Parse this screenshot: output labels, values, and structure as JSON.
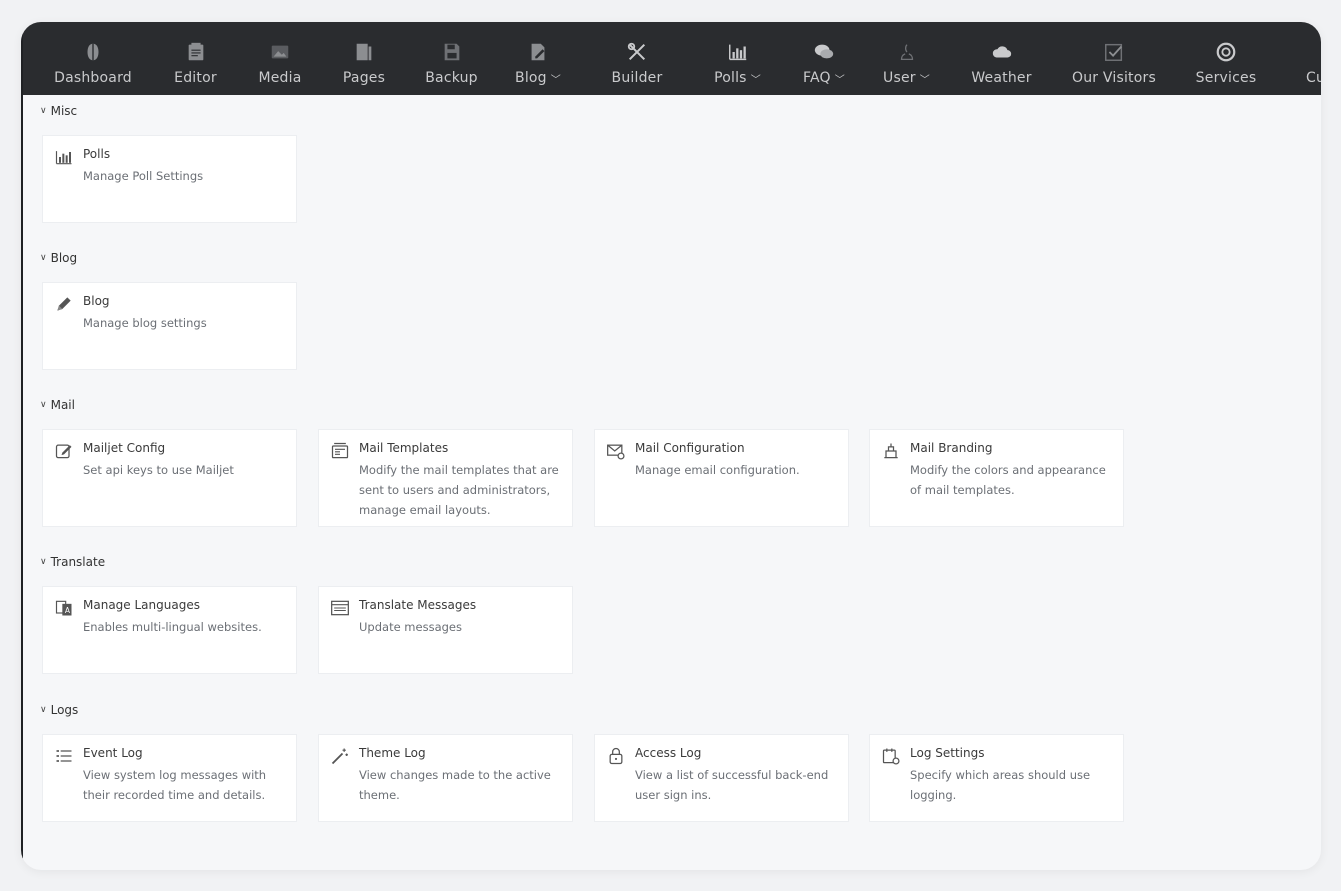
{
  "nav": {
    "items": [
      {
        "label": "Dashboard",
        "icon": "dashboard-icon",
        "caret": false
      },
      {
        "label": "Editor",
        "icon": "editor-icon",
        "caret": false
      },
      {
        "label": "Media",
        "icon": "media-icon",
        "caret": false
      },
      {
        "label": "Pages",
        "icon": "pages-icon",
        "caret": false
      },
      {
        "label": "Backup",
        "icon": "backup-icon",
        "caret": false
      },
      {
        "label": "Blog",
        "icon": "blog-icon",
        "caret": true
      },
      {
        "label": "Builder",
        "icon": "builder-icon",
        "caret": false
      },
      {
        "label": "Polls",
        "icon": "polls-icon",
        "caret": true
      },
      {
        "label": "FAQ",
        "icon": "faq-icon",
        "caret": true
      },
      {
        "label": "User",
        "icon": "user-icon",
        "caret": true
      },
      {
        "label": "Weather",
        "icon": "weather-icon",
        "caret": false
      },
      {
        "label": "Our Visitors",
        "icon": "visitors-icon",
        "caret": false
      },
      {
        "label": "Services",
        "icon": "services-icon",
        "caret": false
      },
      {
        "label": "Custo",
        "icon": "",
        "caret": false
      }
    ]
  },
  "sections": [
    {
      "label": "Misc",
      "cards": [
        {
          "title": "Polls",
          "desc": "Manage Poll Settings",
          "icon": "polls-icon"
        }
      ]
    },
    {
      "label": "Blog",
      "cards": [
        {
          "title": "Blog",
          "desc": "Manage blog settings",
          "icon": "pencil-icon"
        }
      ]
    },
    {
      "label": "Mail",
      "cards": [
        {
          "title": "Mailjet Config",
          "desc": "Set api keys to use Mailjet",
          "icon": "edit-icon"
        },
        {
          "title": "Mail Templates",
          "desc": "Modify the mail templates that are sent to users and administrators, manage email layouts.",
          "icon": "mail-templates-icon"
        },
        {
          "title": "Mail Configuration",
          "desc": "Manage email configuration.",
          "icon": "mail-config-icon"
        },
        {
          "title": "Mail Branding",
          "desc": "Modify the colors and appearance of mail templates.",
          "icon": "mail-branding-icon"
        }
      ]
    },
    {
      "label": "Translate",
      "cards": [
        {
          "title": "Manage Languages",
          "desc": "Enables multi-lingual websites.",
          "icon": "languages-icon"
        },
        {
          "title": "Translate Messages",
          "desc": "Update messages",
          "icon": "translate-messages-icon"
        }
      ]
    },
    {
      "label": "Logs",
      "cards": [
        {
          "title": "Event Log",
          "desc": "View system log messages with their recorded time and details.",
          "icon": "list-icon"
        },
        {
          "title": "Theme Log",
          "desc": "View changes made to the active theme.",
          "icon": "magic-wand-icon"
        },
        {
          "title": "Access Log",
          "desc": "View a list of successful back-end user sign ins.",
          "icon": "lock-icon"
        },
        {
          "title": "Log Settings",
          "desc": "Specify which areas should use logging.",
          "icon": "calendar-settings-icon"
        }
      ]
    }
  ]
}
